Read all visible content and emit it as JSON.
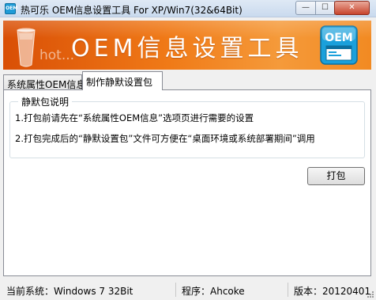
{
  "window": {
    "icon_text": "OEM",
    "title": "热可乐 OEM信息设置工具 For XP/Win7(32&64Bit)",
    "controls": {
      "minimize": "—",
      "maximize": "☐",
      "close": "✕"
    }
  },
  "banner": {
    "hot_text": "hot...",
    "title": "OEM信息设置工具",
    "logo_text": "OEM",
    "colors": {
      "start": "#d94f06",
      "end": "#f59a3a",
      "logo": "#1aa0db"
    }
  },
  "tabs": [
    {
      "label": "系统属性OEM信息",
      "selected": false
    },
    {
      "label": "制作静默设置包",
      "selected": true
    }
  ],
  "silent_panel": {
    "group_title": "静默包说明",
    "line1": "1.打包前请先在“系统属性OEM信息”选项页进行需要的设置",
    "line2": "2.打包完成后的“静默设置包”文件可方便在“桌面环境或系统部署期间”调用",
    "pack_button": "打包"
  },
  "statusbar": {
    "system": "当前系统：Windows 7 32Bit",
    "author": "程序：Ahcoke",
    "version": "版本：20120401"
  }
}
